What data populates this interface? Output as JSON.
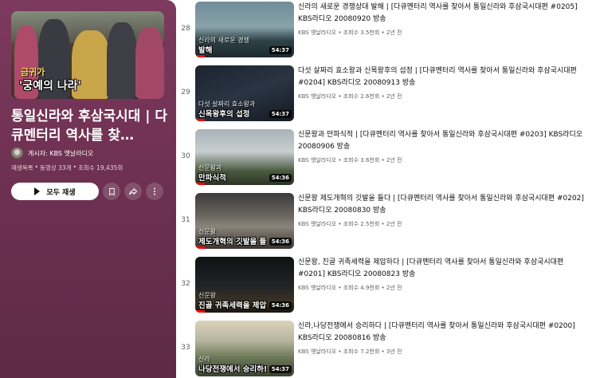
{
  "playlist": {
    "cover_subtitle": "금귀가",
    "cover_title": "'궁예의 나라'",
    "title": "통일신라와 후삼국시대 | 다큐멘터리 역사를 찾…",
    "owner": "게시자: KBS 옛날라디오",
    "meta": [
      "재생목록",
      "동영상 33개",
      "조회수 19,435회"
    ],
    "play_all_label": "모두 재생"
  },
  "videos": [
    {
      "index": "28",
      "title": "신라의 새로운 경쟁상대 발해 | [다큐멘터리 역사를 찾아서 통일신라와 후삼국시대편 #0205] KBS라디오 20080920 방송",
      "meta": "KBS 옛날라디오 • 조회수 3.5천회 • 2년 전",
      "duration": "54:37",
      "caption": "발해",
      "caption_top": "신라의 새로운 경쟁",
      "progress": 0.1
    },
    {
      "index": "29",
      "title": "다섯 살짜리 효소왕과 신목왕후의 섭정 | [다큐멘터리 역사를 찾아서 통일신라와 후삼국시대편 #0204] KBS라디오 20080913 방송",
      "meta": "KBS 옛날라디오 • 조회수 2.6천회 • 2년 전",
      "duration": "54:37",
      "caption": "신목왕후의 섭정",
      "caption_top": "다섯 살짜리 효소왕과",
      "progress": 0.1
    },
    {
      "index": "30",
      "title": "신문왕과 만파식적 | [다큐멘터리 역사를 찾아서 통일신라와 후삼국시대편 #0203] KBS라디오 20080906 방송",
      "meta": "KBS 옛날라디오 • 조회수 3.6천회 • 2년 전",
      "duration": "54:36",
      "caption": "만파식적",
      "caption_top": "신문왕과",
      "progress": 0.1
    },
    {
      "index": "31",
      "title": "신문왕 제도개혁의 깃발을 들다 | [다큐멘터리 역사를 찾아서 통일신라와 후삼국시대편 #0202] KBS라디오 20080830 방송",
      "meta": "KBS 옛날라디오 • 조회수 2.5천회 • 2년 전",
      "duration": "54:36",
      "caption": "제도개혁의 깃발을 들",
      "caption_top": "신문왕",
      "progress": 0.1
    },
    {
      "index": "32",
      "title": "신문왕, 진골 귀족세력을 제압하다 | [다큐멘터리 역사를 찾아서 통일신라와 후삼국시대편 #0201] KBS라디오 20080823 방송",
      "meta": "KBS 옛날라디오 • 조회수 4.9천회 • 2년 전",
      "duration": "54:36",
      "caption": "진골 귀족세력을 제압",
      "caption_top": "신문왕",
      "progress": 0.1
    },
    {
      "index": "33",
      "title": "신라,나당전쟁에서 승리하다 | [다큐멘터리 역사를 찾아서 통일신라와 후삼국시대편 #0200] KBS라디오 20080816 방송",
      "meta": "KBS 옛날라디오 • 조회수 7.2천회 • 3년 전",
      "duration": "54:37",
      "caption": "나당전쟁에서 승리하!",
      "caption_top": "신라",
      "progress": 0
    }
  ]
}
